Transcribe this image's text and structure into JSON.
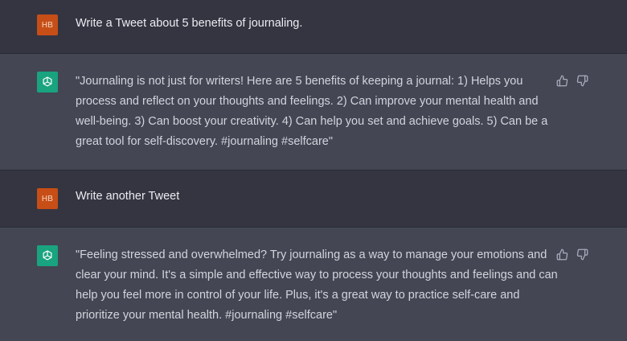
{
  "colors": {
    "user_bg": "#343541",
    "assistant_bg": "#444654",
    "user_avatar": "#c74e16",
    "bot_avatar": "#19a37f",
    "text": "#d1d5db"
  },
  "messages": [
    {
      "role": "user",
      "avatar": "HB",
      "text": "Write a Tweet about 5 benefits of journaling."
    },
    {
      "role": "assistant",
      "avatar_icon": "openai-logo-icon",
      "text": "\"Journaling is not just for writers! Here are 5 benefits of keeping a journal: 1) Helps you process and reflect on your thoughts and feelings. 2) Can improve your mental health and well-being. 3) Can boost your creativity. 4) Can help you set and achieve goals. 5) Can be a great tool for self-discovery. #journaling #selfcare\"",
      "feedback_icons": [
        "thumbs-up-icon",
        "thumbs-down-icon"
      ]
    },
    {
      "role": "user",
      "avatar": "HB",
      "text": "Write another Tweet"
    },
    {
      "role": "assistant",
      "avatar_icon": "openai-logo-icon",
      "text": "\"Feeling stressed and overwhelmed? Try journaling as a way to manage your emotions and clear your mind. It's a simple and effective way to process your thoughts and feelings and can help you feel more in control of your life. Plus, it's a great way to practice self-care and prioritize your mental health. #journaling #selfcare\"",
      "feedback_icons": [
        "thumbs-up-icon",
        "thumbs-down-icon"
      ]
    }
  ]
}
